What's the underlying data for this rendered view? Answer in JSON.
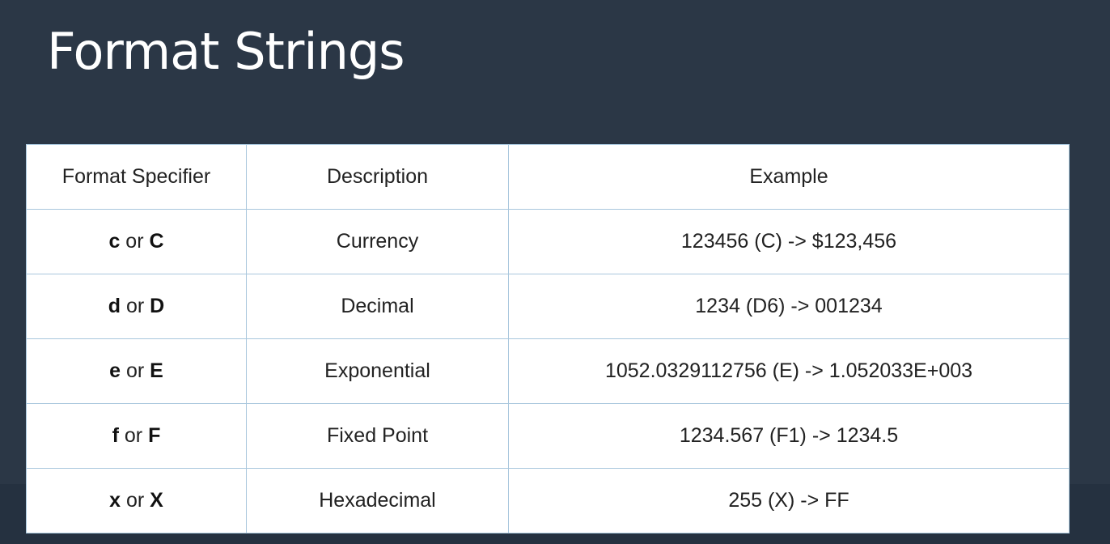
{
  "slide": {
    "title": "Format Strings"
  },
  "table": {
    "headers": {
      "specifier": "Format Specifier",
      "description": "Description",
      "example": "Example"
    },
    "rows": [
      {
        "lower": "c",
        "separator": " or ",
        "upper": "C",
        "description": "Currency",
        "example": "123456 (C) -> $123,456"
      },
      {
        "lower": "d",
        "separator": " or ",
        "upper": "D",
        "description": "Decimal",
        "example": "1234 (D6) -> 001234"
      },
      {
        "lower": "e",
        "separator": " or ",
        "upper": "E",
        "description": "Exponential",
        "example": "1052.0329112756 (E) -> 1.052033E+003"
      },
      {
        "lower": "f",
        "separator": " or ",
        "upper": "F",
        "description": "Fixed Point",
        "example": "1234.567 (F1) -> 1234.5"
      },
      {
        "lower": "x",
        "separator": " or ",
        "upper": "X",
        "description": "Hexadecimal",
        "example": "255 (X) -> FF"
      }
    ]
  }
}
